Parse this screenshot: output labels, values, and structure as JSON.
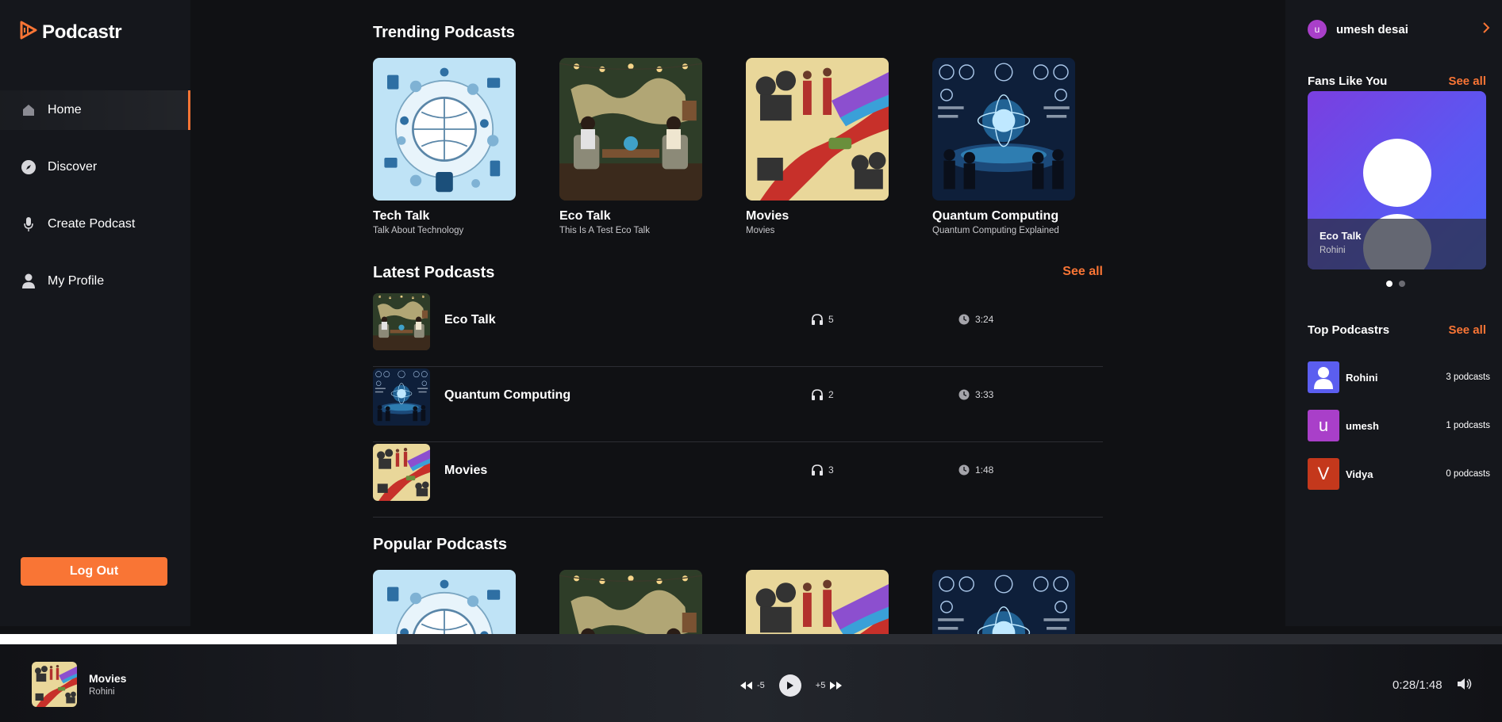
{
  "app": {
    "name": "Podcastr"
  },
  "sidebar": {
    "items": [
      {
        "label": "Home",
        "icon": "home-icon",
        "active": true
      },
      {
        "label": "Discover",
        "icon": "compass-icon",
        "active": false
      },
      {
        "label": "Create Podcast",
        "icon": "microphone-icon",
        "active": false
      },
      {
        "label": "My Profile",
        "icon": "user-icon",
        "active": false
      }
    ],
    "logout_label": "Log Out"
  },
  "trending": {
    "title": "Trending Podcasts",
    "cards": [
      {
        "title": "Tech Talk",
        "desc": "Talk About Technology",
        "art": "tech"
      },
      {
        "title": "Eco Talk",
        "desc": "This Is A Test Eco Talk",
        "art": "eco"
      },
      {
        "title": "Movies",
        "desc": "Movies",
        "art": "movies"
      },
      {
        "title": "Quantum Computing",
        "desc": "Quantum Computing Explained",
        "art": "quantum"
      }
    ]
  },
  "latest": {
    "title": "Latest Podcasts",
    "see_all": "See all",
    "rows": [
      {
        "name": "Eco Talk",
        "listens": "5",
        "duration": "3:24",
        "art": "eco"
      },
      {
        "name": "Quantum Computing",
        "listens": "2",
        "duration": "3:33",
        "art": "quantum"
      },
      {
        "name": "Movies",
        "listens": "3",
        "duration": "1:48",
        "art": "movies"
      }
    ]
  },
  "popular": {
    "title": "Popular Podcasts"
  },
  "rightbar": {
    "user": {
      "initial": "u",
      "name": "umesh desai"
    },
    "fans": {
      "title": "Fans Like You",
      "see_all": "See all",
      "card": {
        "title": "Eco Talk",
        "author": "Rohini"
      },
      "active_slide": 1,
      "slide_count": 2
    },
    "top": {
      "title": "Top Podcastrs",
      "see_all": "See all",
      "rows": [
        {
          "name": "Rohini",
          "count": "3 podcasts",
          "initial": "",
          "color": "#5b5ef0"
        },
        {
          "name": "umesh",
          "count": "1 podcasts",
          "initial": "u",
          "color": "#a93fc9"
        },
        {
          "name": "Vidya",
          "count": "0 podcasts",
          "initial": "V",
          "color": "#c4381c"
        }
      ]
    }
  },
  "player": {
    "title": "Movies",
    "author": "Rohini",
    "back_label": "-5",
    "forward_label": "+5",
    "time": "0:28/1:48",
    "progress": 0.264
  },
  "colors": {
    "accent": "#f97535",
    "bg": "#101114",
    "panel": "#15171c"
  }
}
